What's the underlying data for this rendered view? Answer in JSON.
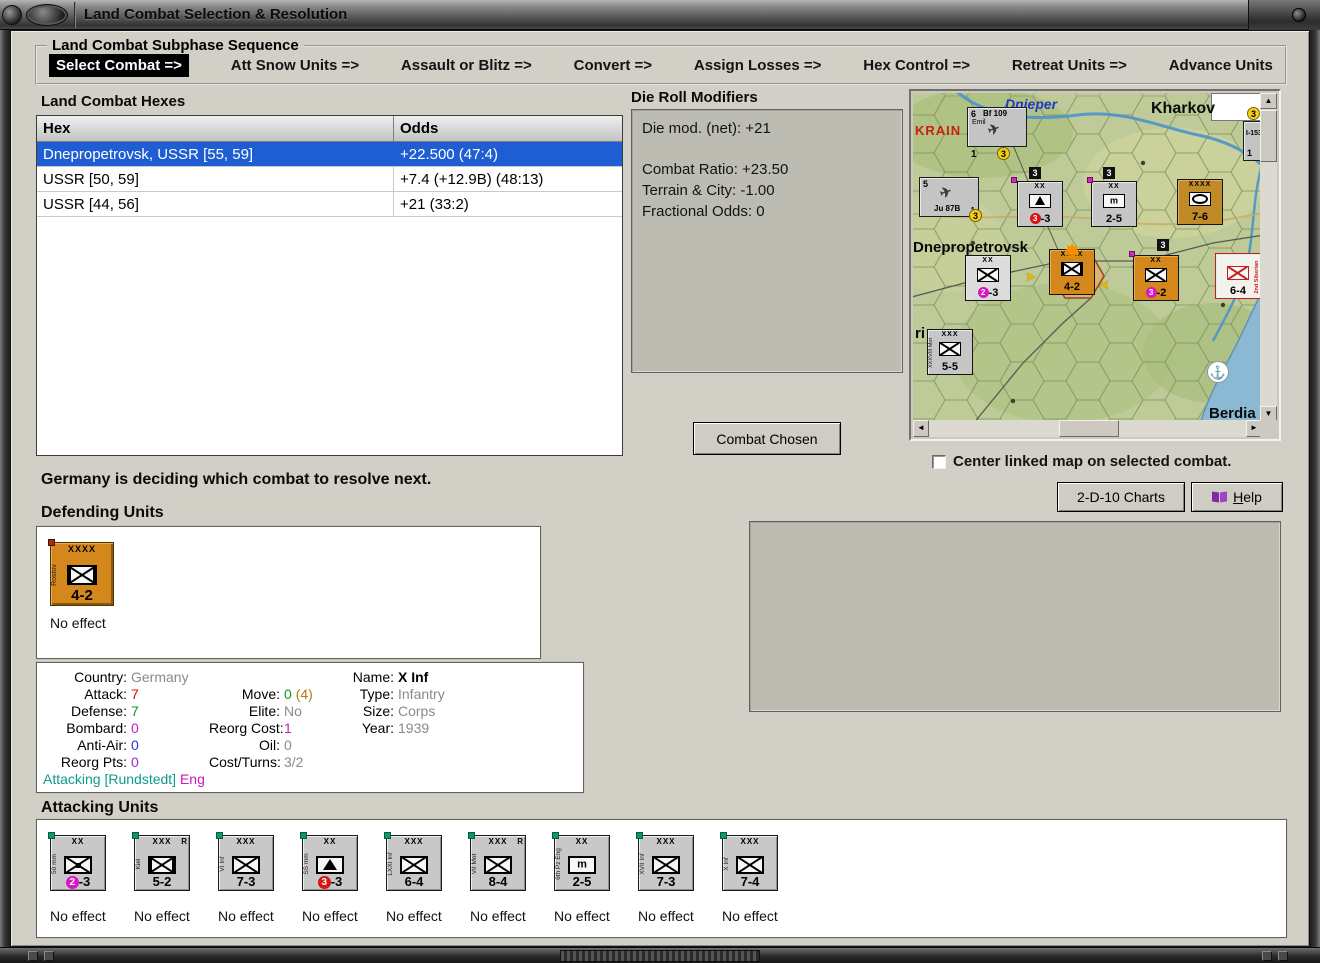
{
  "window": {
    "title": "Land Combat Selection & Resolution"
  },
  "icons": {
    "scroll_up": "▲",
    "scroll_down": "▼",
    "scroll_left": "◄",
    "scroll_right": "►",
    "anchor": "⚓",
    "explosion": "✸",
    "arrow_right": "➤",
    "arrow_left": "➤",
    "plane": "✈"
  },
  "sequence": {
    "title": "Land Combat Subphase Sequence",
    "steps": [
      "Select Combat =>",
      "Att Snow Units =>",
      "Assault or Blitz =>",
      "Convert =>",
      "Assign Losses =>",
      "Hex Control =>",
      "Retreat Units =>",
      "Advance Units"
    ]
  },
  "hexes": {
    "title": "Land Combat Hexes",
    "columns": {
      "hex": "Hex",
      "odds": "Odds"
    },
    "rows": [
      {
        "hex": "Dnepropetrovsk, USSR [55, 59]",
        "odds": "+22.500 (47:4)"
      },
      {
        "hex": "USSR [50, 59]",
        "odds": "+7.4 (+12.9B) (48:13)"
      },
      {
        "hex": "USSR [44, 56]",
        "odds": "+21 (33:2)"
      }
    ]
  },
  "modifiers": {
    "title": "Die Roll Modifiers",
    "net": "Die mod. (net): +21",
    "ratio": "Combat Ratio: +23.50",
    "terrain": "Terrain & City: -1.00",
    "fractional": "Fractional Odds: 0"
  },
  "buttons": {
    "combat_chosen": "Combat Chosen",
    "charts": "2-D-10 Charts",
    "help": "Help"
  },
  "checkbox": {
    "label": "Center linked map on selected combat."
  },
  "status": "Germany is deciding which combat to resolve next.",
  "defending": {
    "title": "Defending Units",
    "unit": {
      "name": "Rostov",
      "size": "XXXX",
      "strength": "4-2",
      "effect": "No effect"
    }
  },
  "details": {
    "country_label": "Country:",
    "country": "Germany",
    "attack_label": "Attack:",
    "attack": "7",
    "defense_label": "Defense:",
    "defense": "7",
    "bombard_label": "Bombard:",
    "bombard": "0",
    "antiair_label": "Anti-Air:",
    "antiair": "0",
    "reorgpts_label": "Reorg Pts:",
    "reorgpts": "0",
    "move_label": "Move:",
    "move": "0",
    "move_paren": "(4)",
    "elite_label": "Elite:",
    "elite": "No",
    "reorgcost_label": "Reorg Cost:",
    "reorgcost": "1",
    "oil_label": "Oil:",
    "oil": "0",
    "costturns_label": "Cost/Turns:",
    "costturns": "3/2",
    "name_label": "Name:",
    "name": "X Inf",
    "type_label": "Type:",
    "type": "Infantry",
    "size_label": "Size:",
    "size": "Corps",
    "year_label": "Year:",
    "year": "1939",
    "footer_main": "Attacking [Rundstedt]",
    "footer_tag": "Eng"
  },
  "attacking": {
    "title": "Attacking Units",
    "units": [
      {
        "name": "50 mm",
        "size": "XX",
        "chip": "2",
        "rest": "-3",
        "effect": "No effect"
      },
      {
        "name": "Kiel",
        "size": "XXX",
        "corner": "R",
        "rest": "5-2",
        "effect": "No effect"
      },
      {
        "name": "VI Inf",
        "size": "XXX",
        "rest": "7-3",
        "effect": "No effect"
      },
      {
        "name": "SS mm",
        "size": "XX",
        "chip": "3",
        "rest": "-3",
        "effect": "No effect"
      },
      {
        "name": "LXXI Inf",
        "size": "XXX",
        "rest": "6-4",
        "effect": "No effect"
      },
      {
        "name": "VII Mot",
        "size": "XXX",
        "corner": "R",
        "rest": "8-4",
        "effect": "No effect"
      },
      {
        "name": "6th Pz Eng",
        "size": "XX",
        "rest": "2-5",
        "effect": "No effect"
      },
      {
        "name": "XVII Inf",
        "size": "XXX",
        "rest": "7-3",
        "effect": "No effect"
      },
      {
        "name": "X Inf",
        "size": "XXX",
        "rest": "7-4",
        "effect": "No effect"
      }
    ]
  },
  "map": {
    "labels": {
      "river": "Dnieper",
      "city_ne": "Kharkov",
      "region": "KRAIN",
      "city_main": "Dnepropetrovsk",
      "edge": "ri",
      "city_s": "Berdia"
    },
    "air1": {
      "count": "6",
      "name": "Bf 109",
      "sub": "Emil",
      "marker": "1",
      "badge": "3"
    },
    "air2": {
      "count": "5",
      "name": "Ju 87B",
      "marker": "1",
      "badge": "3"
    },
    "air3": {
      "name": "I-153",
      "marker": "1",
      "badge": "3"
    },
    "stacks": [
      "3",
      "3",
      "3"
    ],
    "units": [
      {
        "size": "XX",
        "chip": "3",
        "rest": "-3"
      },
      {
        "size": "XX",
        "rest": "2-5"
      },
      {
        "size": "XXXX",
        "rest": "7-6"
      },
      {
        "size": "XX",
        "chip": "2",
        "rest": "-3"
      },
      {
        "size": "XXXX",
        "rest": "4-2"
      },
      {
        "size": "XX",
        "chip": "3",
        "rest": "-2"
      },
      {
        "name": "2nd Siberian",
        "rest": "6-4"
      },
      {
        "name": "XXXVIII Mot",
        "size": "XXX",
        "rest": "5-5"
      }
    ]
  }
}
